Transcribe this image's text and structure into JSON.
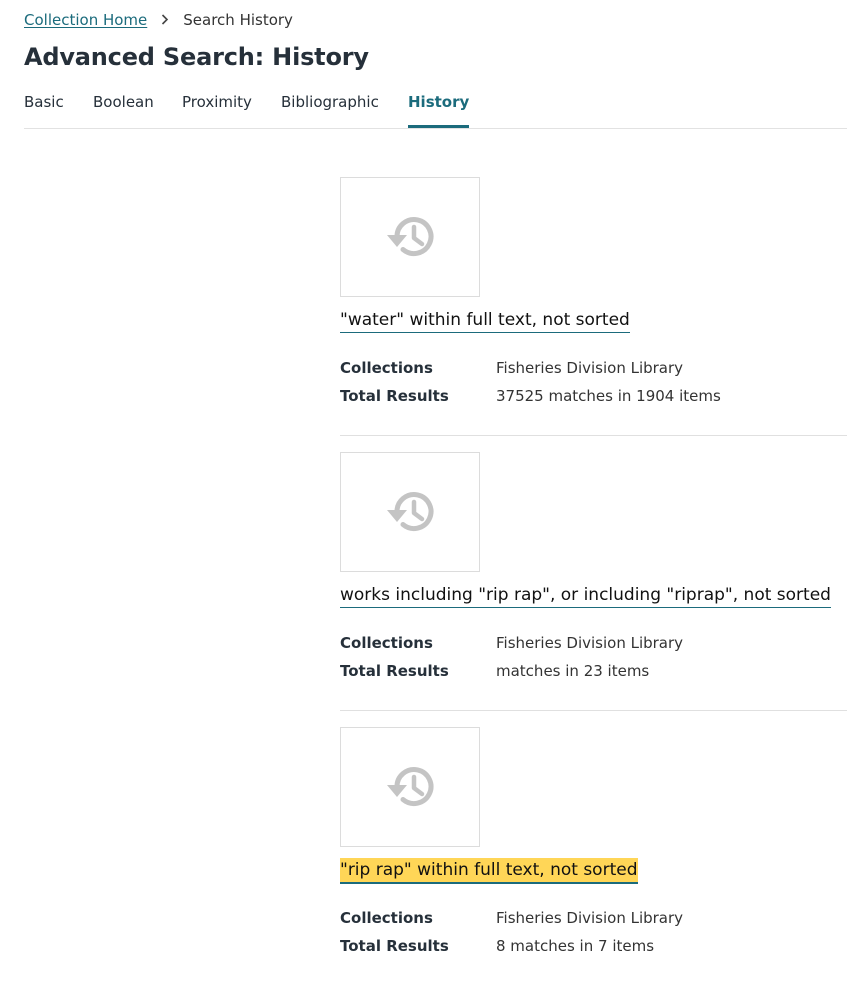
{
  "breadcrumb": {
    "home_label": "Collection Home",
    "separator_icon": "chevron-right-icon",
    "current_label": "Search History"
  },
  "page": {
    "title": "Advanced Search: History"
  },
  "tabs": [
    {
      "label": "Basic",
      "active": false
    },
    {
      "label": "Boolean",
      "active": false
    },
    {
      "label": "Proximity",
      "active": false
    },
    {
      "label": "Bibliographic",
      "active": false
    },
    {
      "label": "History",
      "active": true
    }
  ],
  "history": {
    "thumbnail_icon": "history-icon",
    "collections_label": "Collections",
    "total_results_label": "Total Results",
    "entries": [
      {
        "query": "\"water\" within full text, not sorted",
        "collections": "Fisheries Division Library",
        "total_results": "37525 matches in 1904 items",
        "highlighted": false
      },
      {
        "query": "works including \"rip rap\", or including \"riprap\", not sorted",
        "collections": "Fisheries Division Library",
        "total_results": "matches in 23 items",
        "highlighted": false
      },
      {
        "query": "\"rip rap\" within full text, not sorted",
        "collections": "Fisheries Division Library",
        "total_results": "8 matches in 7 items",
        "highlighted": true
      }
    ]
  },
  "colors": {
    "accent": "#1b6b7c",
    "highlight": "#ffd657",
    "icon_gray": "#c4c4c4"
  }
}
